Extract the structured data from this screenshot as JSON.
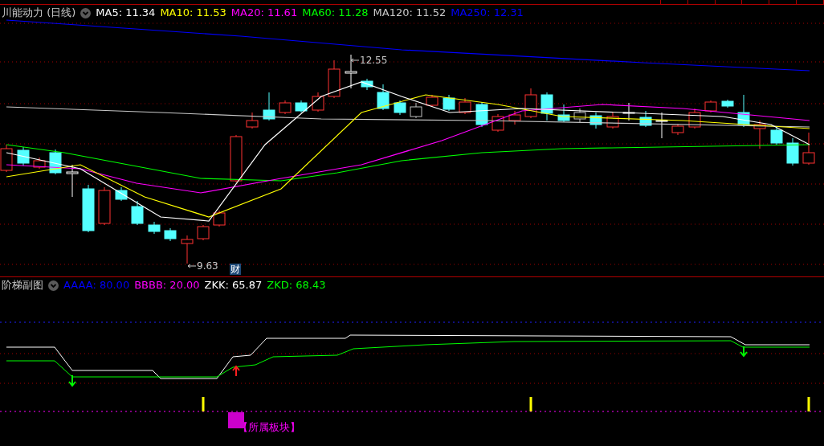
{
  "price_panel": {
    "title": "川能动力 (日线)",
    "indicators": [
      {
        "text": "MA5: 11.34",
        "color": "#ffffff"
      },
      {
        "text": "MA10: 11.53",
        "color": "#ffff00"
      },
      {
        "text": "MA20: 11.61",
        "color": "#ff00ff"
      },
      {
        "text": "MA60: 11.28",
        "color": "#00ff00"
      },
      {
        "text": "MA120: 11.52",
        "color": "#c8c8c8"
      },
      {
        "text": "MA250: 12.31",
        "color": "#0000ff"
      }
    ],
    "annotations": [
      {
        "kind": "high",
        "text": "12.55"
      },
      {
        "kind": "low",
        "text": "9.63"
      }
    ],
    "badge": "财"
  },
  "sub_panel": {
    "title": "阶梯副图",
    "indicators": [
      {
        "text": "AAAA: 80.00",
        "color": "#0000ff"
      },
      {
        "text": "BBBB: 20.00",
        "color": "#ff00ff"
      },
      {
        "text": "ZKK: 65.87",
        "color": "#ffffff"
      },
      {
        "text": "ZKD: 68.43",
        "color": "#00ff00"
      }
    ],
    "tag": "【所属板块】"
  }
}
